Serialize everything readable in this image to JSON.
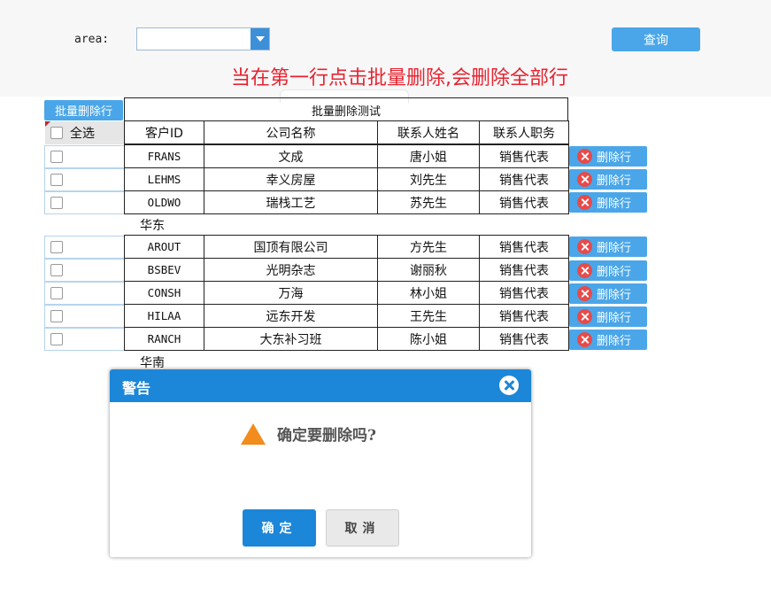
{
  "filter": {
    "area_label": "area:",
    "area_value": "",
    "query_label": "查询"
  },
  "warning_note": "当在第一行点击批量删除,会删除全部行",
  "grid": {
    "batch_delete_label": "批量删除行",
    "caption": "批量删除测试",
    "select_all_label": "全选",
    "columns": [
      "客户ID",
      "公司名称",
      "联系人姓名",
      "联系人职务"
    ],
    "delete_row_label": "删除行",
    "groups": [
      {
        "label": "华东",
        "rows": [
          [
            "FRANS",
            "文成",
            "唐小姐",
            "销售代表"
          ],
          [
            "LEHMS",
            "幸义房屋",
            "刘先生",
            "销售代表"
          ],
          [
            "OLDWO",
            "瑞栈工艺",
            "苏先生",
            "销售代表"
          ]
        ]
      },
      {
        "label": "华南",
        "rows": [
          [
            "AROUT",
            "国顶有限公司",
            "方先生",
            "销售代表"
          ],
          [
            "BSBEV",
            "光明杂志",
            "谢丽秋",
            "销售代表"
          ],
          [
            "CONSH",
            "万海",
            "林小姐",
            "销售代表"
          ],
          [
            "HILAA",
            "远东开发",
            "王先生",
            "销售代表"
          ],
          [
            "RANCH",
            "大东补习班",
            "陈小姐",
            "销售代表"
          ]
        ]
      }
    ]
  },
  "dialog": {
    "title": "警告",
    "message": "确定要删除吗?",
    "ok_label": "确定",
    "cancel_label": "取消"
  },
  "colors": {
    "accent": "#4aa6e8",
    "dialog_header": "#1c86d8",
    "warning_text": "#e8232f",
    "delete_icon": "#e84a4a",
    "warning_icon": "#f28c1c"
  }
}
